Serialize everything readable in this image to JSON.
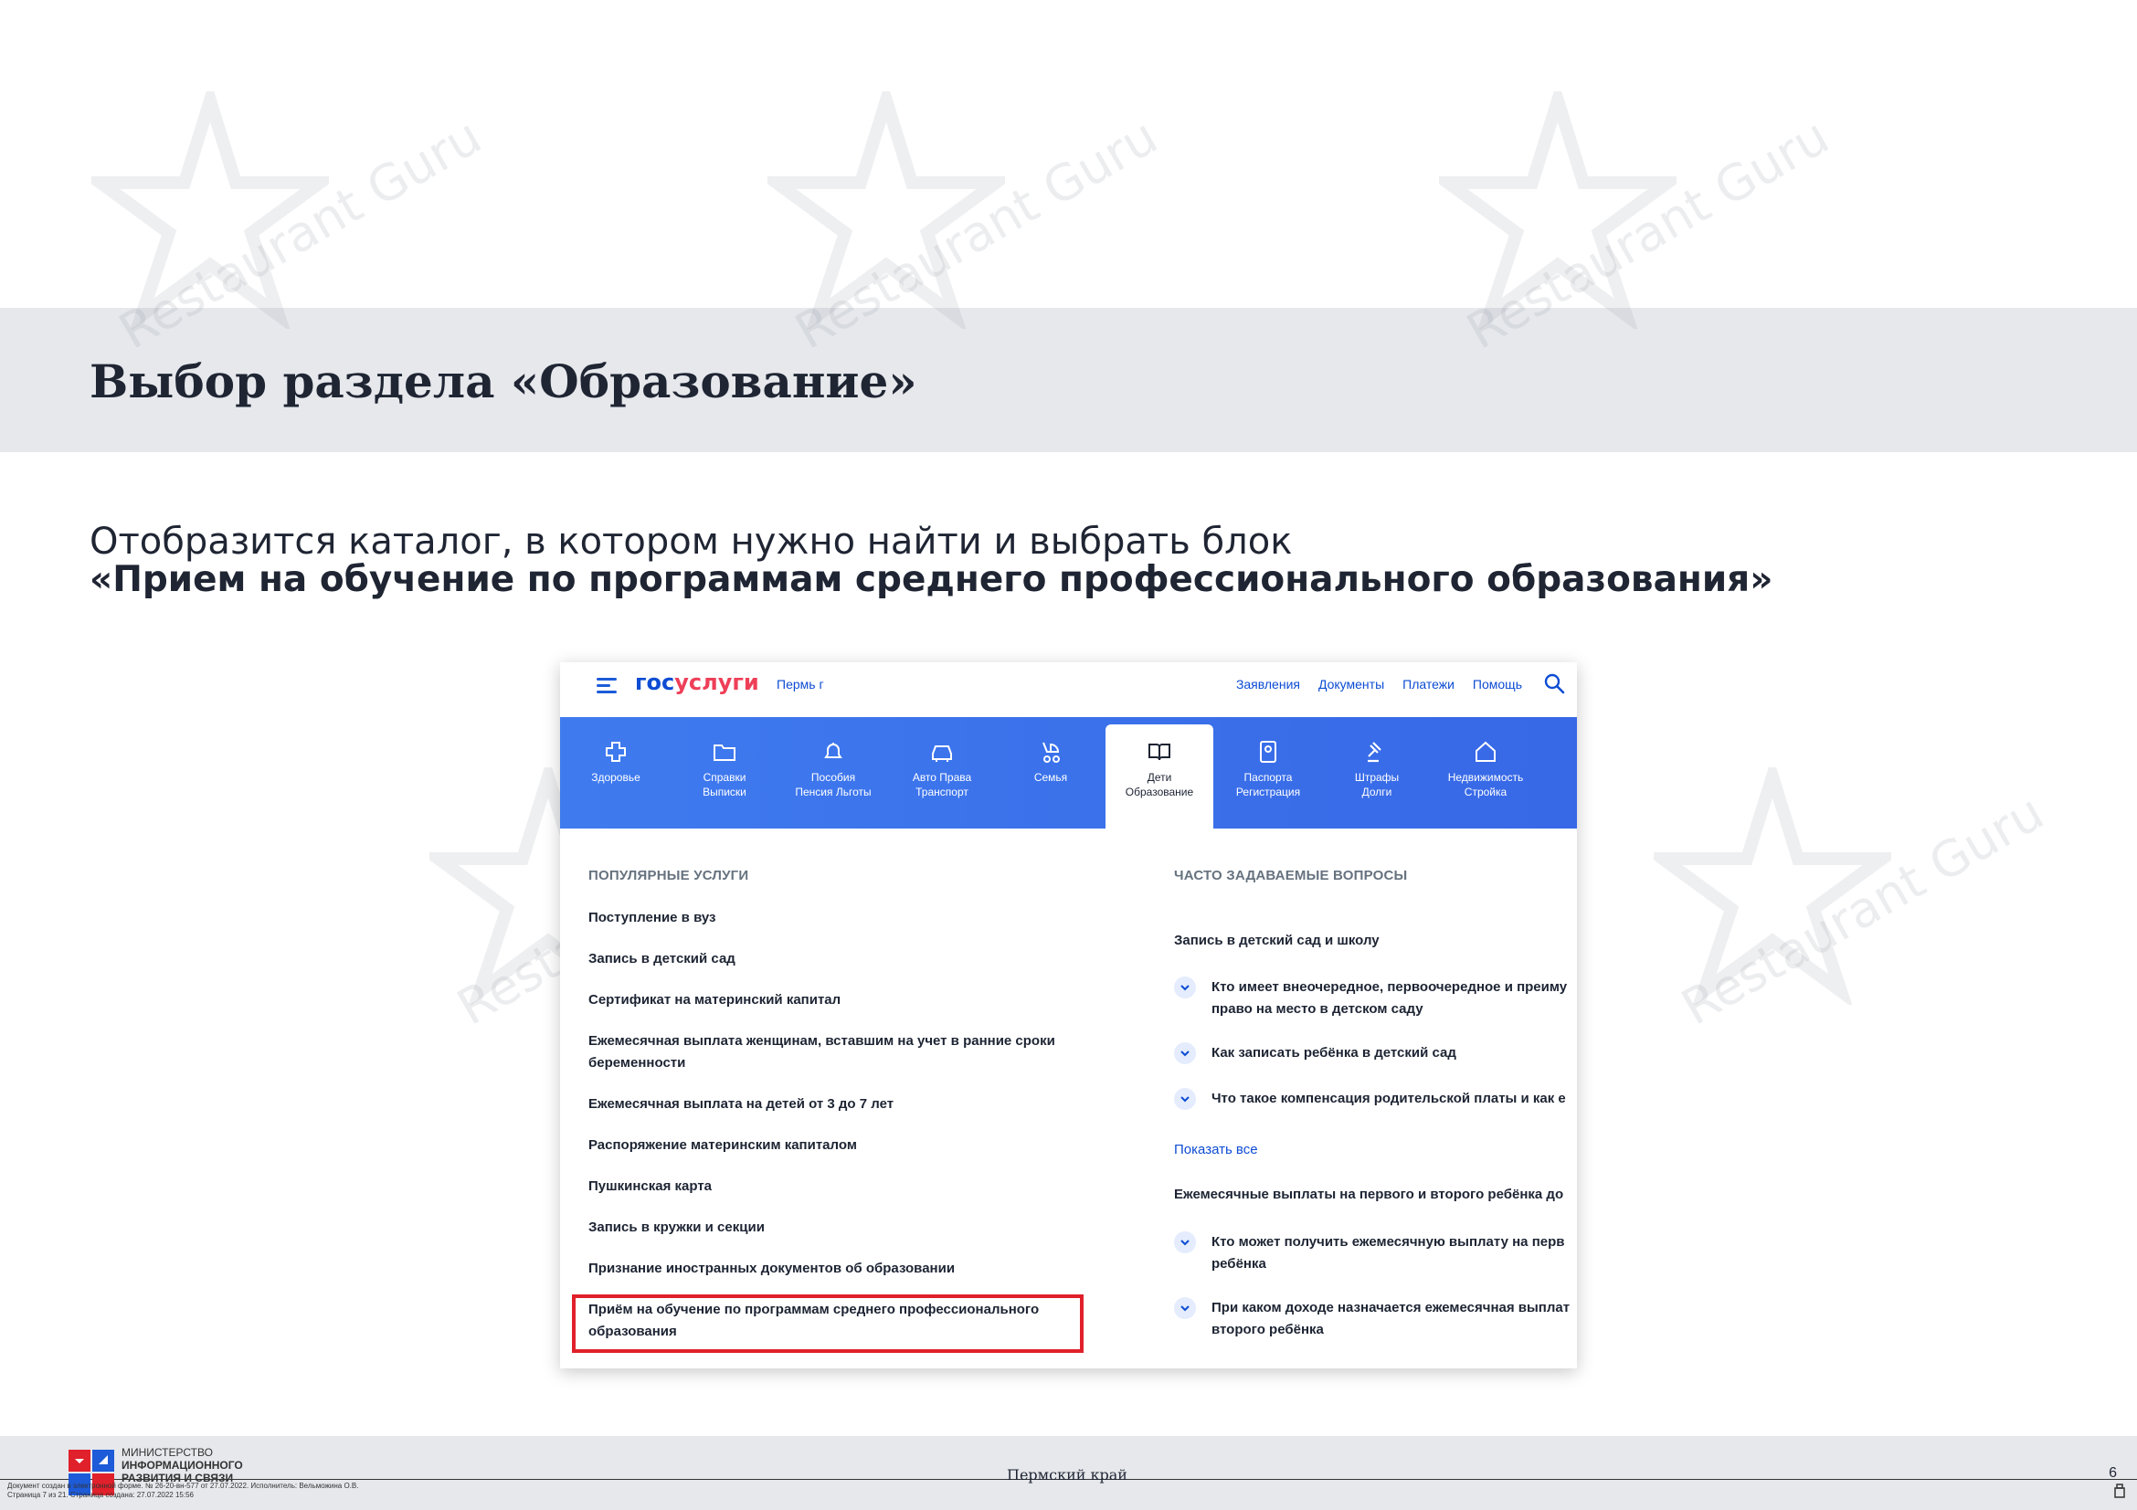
{
  "watermark": {
    "text": "Restaurant Guru"
  },
  "slide": {
    "title": "Выбор раздела «Образование»",
    "subtitle_line1": "Отобразится каталог, в котором нужно найти и выбрать блок",
    "subtitle_line2": "«Прием на обучение по программам среднего профессионального образования»"
  },
  "portal": {
    "logo_part1": "гос",
    "logo_part2": "услуги",
    "region": "Пермь г",
    "nav": [
      "Заявления",
      "Документы",
      "Платежи",
      "Помощь"
    ],
    "categories": [
      {
        "line1": "Здоровье",
        "line2": "",
        "icon": "health-cross-icon"
      },
      {
        "line1": "Справки",
        "line2": "Выписки",
        "icon": "folder-icon"
      },
      {
        "line1": "Пособия",
        "line2": "Пенсия Льготы",
        "icon": "bell-icon"
      },
      {
        "line1": "Авто Права",
        "line2": "Транспорт",
        "icon": "car-icon"
      },
      {
        "line1": "Семья",
        "line2": "",
        "icon": "stroller-icon"
      },
      {
        "line1": "Дети",
        "line2": "Образование",
        "icon": "book-icon"
      },
      {
        "line1": "Паспорта",
        "line2": "Регистрация",
        "icon": "passport-icon"
      },
      {
        "line1": "Штрафы",
        "line2": "Долги",
        "icon": "gavel-icon"
      },
      {
        "line1": "Недвижимость",
        "line2": "Стройка",
        "icon": "house-icon"
      }
    ],
    "active_category": "Дети Образование",
    "popular_heading": "ПОПУЛЯРНЫЕ УСЛУГИ",
    "popular": [
      "Поступление в вуз",
      "Запись в детский сад",
      "Сертификат на материнский капитал",
      "Ежемесячная выплата женщинам, вставшим на учет в ранние сроки беременности",
      "Ежемесячная выплата на детей от 3 до 7 лет",
      "Распоряжение материнским капиталом",
      "Пушкинская карта",
      "Запись в кружки и секции",
      "Признание иностранных документов об образовании",
      "Приём на обучение по программам среднего профессионального образования"
    ],
    "faq_heading": "ЧАСТО ЗАДАВАЕМЫЕ ВОПРОСЫ",
    "faq_group1": "Запись в детский сад и школу",
    "faq_group1_q": [
      "Кто имеет внеочередное, первоочередное и преиму\nправо на место в детском саду",
      "Как записать ребёнка в детский сад",
      "Что такое компенсация родительской платы и как е"
    ],
    "show_all": "Показать все",
    "faq_group2": "Ежемесячные выплаты на первого и второго ребёнка до",
    "faq_group2_q": [
      "Кто может получить ежемесячную выплату на перв\nребёнка",
      "При каком доходе назначается ежемесячная выплат\nвторого ребёнка"
    ]
  },
  "footer": {
    "ministry_line1": "МИНИСТЕРСТВО",
    "ministry_line2": "ИНФОРМАЦИОННОГО",
    "ministry_line3": "РАЗВИТИЯ И СВЯЗИ",
    "region": "Пермский край",
    "page": "6",
    "doc_line1": "Документ создан в электронной форме. № 26-20-вн-577 от 27.07.2022. Исполнитель: Вельможина О.В.",
    "doc_line2": "Страница 7 из 21. Страница создана: 27.07.2022 15:56"
  },
  "colors": {
    "brand_blue": "#0d4cd3",
    "brand_red": "#ee3f58",
    "highlight": "#e0202a",
    "band": "#e6e8ec"
  }
}
